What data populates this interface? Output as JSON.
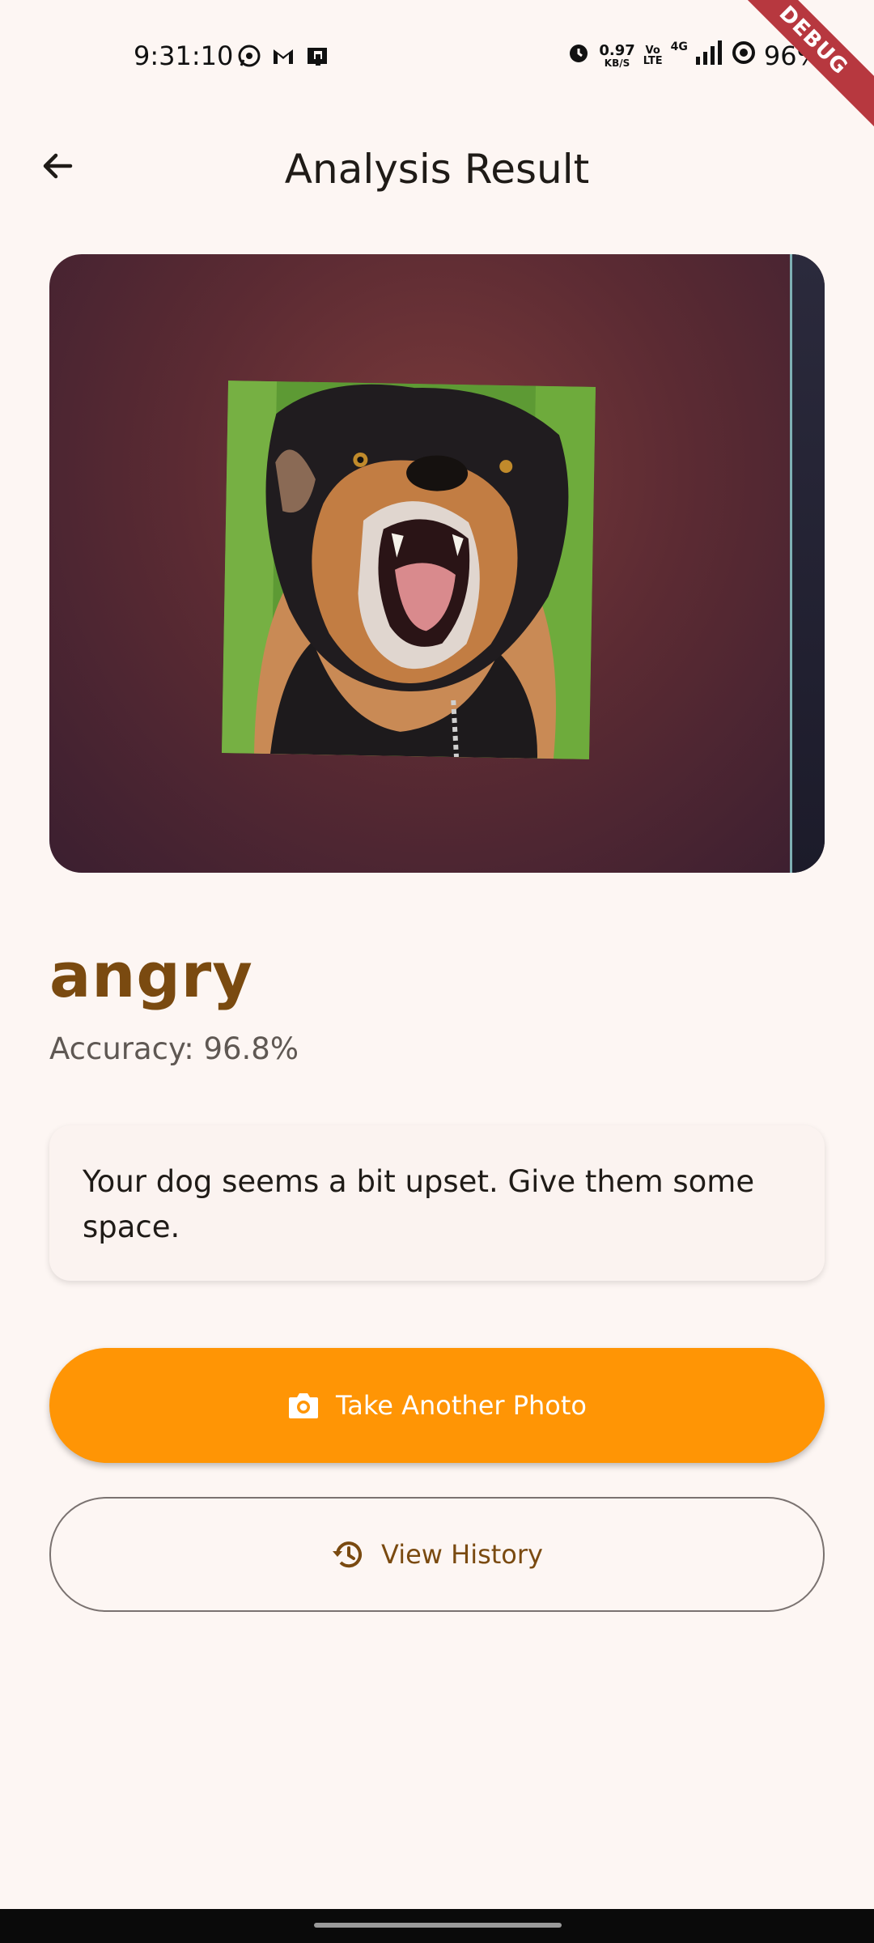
{
  "status_bar": {
    "time": "9:31:10",
    "net_speed_value": "0.97",
    "net_speed_unit": "KB/S",
    "volte_top": "Vo",
    "volte_bottom": "LTE",
    "network_type": "4G",
    "battery": "96%"
  },
  "debug_banner": "DEBUG",
  "app_bar": {
    "title": "Analysis Result"
  },
  "result": {
    "emotion": "angry",
    "accuracy": "Accuracy: 96.8%",
    "message": "Your dog seems a bit upset. Give them some space."
  },
  "actions": {
    "primary_label": "Take Another Photo",
    "primary_icon": "camera-icon",
    "secondary_label": "View History",
    "secondary_icon": "history-icon"
  },
  "colors": {
    "background": "#fdf6f3",
    "accent": "#ff9505",
    "emotion_text": "#7a4a10"
  }
}
